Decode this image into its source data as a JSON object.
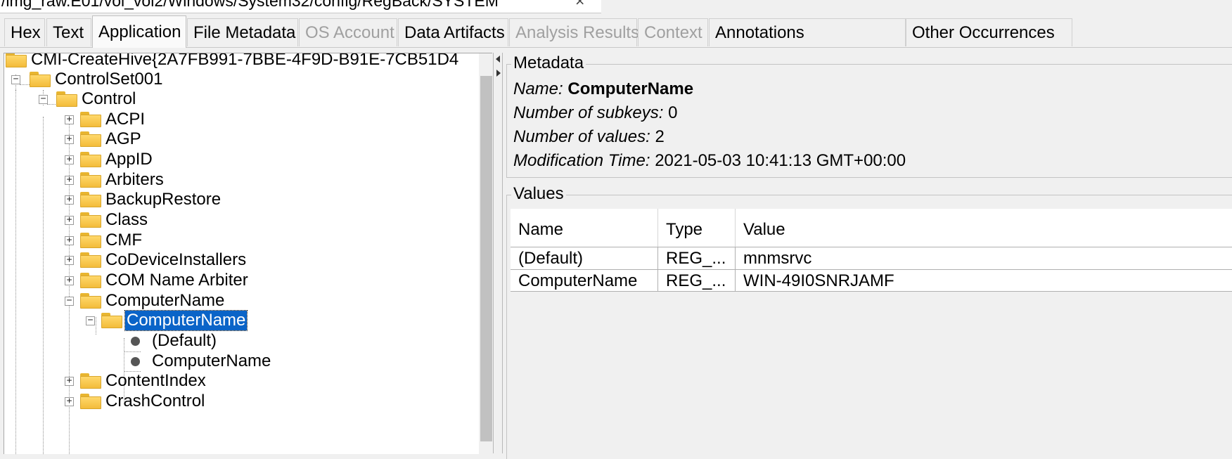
{
  "pathbar": {
    "path": "/img_raw.E01/vol_vol2/Windows/System32/config/RegBack/SYSTEM",
    "close": "×"
  },
  "tabs": [
    {
      "label": "Hex",
      "state": "normal"
    },
    {
      "label": "Text",
      "state": "normal"
    },
    {
      "label": "Application",
      "state": "active"
    },
    {
      "label": "File Metadata",
      "state": "normal"
    },
    {
      "label": "OS Account",
      "state": "disabled"
    },
    {
      "label": "Data Artifacts",
      "state": "normal"
    },
    {
      "label": "Analysis Results",
      "state": "disabled"
    },
    {
      "label": "Context",
      "state": "disabled"
    },
    {
      "label": "Annotations",
      "state": "normal"
    },
    {
      "label": "Other Occurrences",
      "state": "normal"
    }
  ],
  "tree": {
    "nodes": [
      {
        "label": "CMI-CreateHive{2A7FB991-7BBE-4F9D-B91E-7CB51D4",
        "level": 0,
        "icon": "folder-icon",
        "expander": ""
      },
      {
        "label": "ControlSet001",
        "level": 1,
        "icon": "folder-icon",
        "expander": "−"
      },
      {
        "label": "Control",
        "level": 2,
        "icon": "folder-icon",
        "expander": "−"
      },
      {
        "label": "ACPI",
        "level": 3,
        "icon": "folder-icon",
        "expander": "+"
      },
      {
        "label": "AGP",
        "level": 3,
        "icon": "folder-icon",
        "expander": "+"
      },
      {
        "label": "AppID",
        "level": 3,
        "icon": "folder-icon",
        "expander": "+"
      },
      {
        "label": "Arbiters",
        "level": 3,
        "icon": "folder-icon",
        "expander": "+"
      },
      {
        "label": "BackupRestore",
        "level": 3,
        "icon": "folder-icon",
        "expander": "+"
      },
      {
        "label": "Class",
        "level": 3,
        "icon": "folder-icon",
        "expander": "+"
      },
      {
        "label": "CMF",
        "level": 3,
        "icon": "folder-icon",
        "expander": "+"
      },
      {
        "label": "CoDeviceInstallers",
        "level": 3,
        "icon": "folder-icon",
        "expander": "+"
      },
      {
        "label": "COM Name Arbiter",
        "level": 3,
        "icon": "folder-icon",
        "expander": "+"
      },
      {
        "label": "ComputerName",
        "level": 3,
        "icon": "folder-icon",
        "expander": "−"
      },
      {
        "label": "ComputerName",
        "level": 4,
        "icon": "folder-icon",
        "expander": "−",
        "selected": true
      },
      {
        "label": "(Default)",
        "level": 5,
        "icon": "value-dot-icon",
        "expander": ""
      },
      {
        "label": "ComputerName",
        "level": 5,
        "icon": "value-dot-icon",
        "expander": ""
      },
      {
        "label": "ContentIndex",
        "level": 3,
        "icon": "folder-icon",
        "expander": "+"
      },
      {
        "label": "CrashControl",
        "level": 3,
        "icon": "folder-icon",
        "expander": "+"
      }
    ]
  },
  "metadata": {
    "group_title": "Metadata",
    "name_label": "Name:",
    "name_value": "ComputerName",
    "subkeys_label": "Number of subkeys:",
    "subkeys_value": "0",
    "values_label": "Number of values:",
    "values_value": "2",
    "mtime_label": "Modification Time:",
    "mtime_value": "2021-05-03 10:41:13 GMT+00:00"
  },
  "values": {
    "group_title": "Values",
    "columns": [
      "Name",
      "Type",
      "Value"
    ],
    "rows": [
      {
        "name": "(Default)",
        "type": "REG_...",
        "value": "mnmsrvc"
      },
      {
        "name": "ComputerName",
        "type": "REG_...",
        "value": "WIN-49I0SNRJAMF"
      }
    ]
  }
}
